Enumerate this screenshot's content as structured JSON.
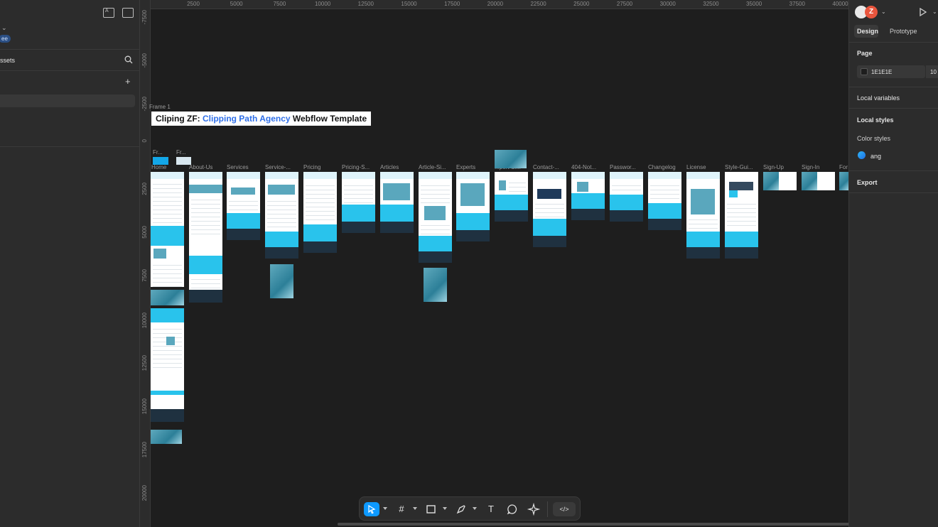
{
  "left_panel": {
    "badge": "ee",
    "assets_tab": "ssets"
  },
  "canvas": {
    "ruler_top": [
      "2500",
      "5000",
      "7500",
      "10000",
      "12500",
      "15000",
      "17500",
      "20000",
      "22500",
      "25000",
      "27500",
      "30000",
      "32500",
      "35000",
      "37500",
      "40000"
    ],
    "ruler_left": [
      "-7500",
      "-5000",
      "-2500",
      "0",
      "2500",
      "5000",
      "7500",
      "10000",
      "12500",
      "15000",
      "17500",
      "20000"
    ],
    "frame_name": "Frame 1",
    "title_prefix": "Cliping ZF: ",
    "title_accent": "Clipping Path Agency",
    "title_suffix": " Webflow Template",
    "small_labels": [
      "Fr...",
      "Fr..."
    ],
    "pages": [
      "Home",
      "About-Us",
      "Services",
      "Service-...",
      "Pricing",
      "Pricing-S...",
      "Articles",
      "Article-Si...",
      "Experts",
      "...pert-Si...",
      "Contact-...",
      "404-Not...",
      "Passwor...",
      "Changelog",
      "License",
      "Style-Gui...",
      "Sign-Up",
      "Sign-In",
      "For"
    ]
  },
  "toolbar": {
    "tools": [
      "move-tool",
      "frame-tool",
      "shape-tool",
      "pen-tool",
      "text-tool",
      "comment-tool",
      "actions-tool",
      "dev-mode"
    ],
    "text_glyph": "T",
    "frame_glyph": "#",
    "dev_glyph": "</>"
  },
  "right_panel": {
    "avatar_letter": "Z",
    "tabs": [
      "Design",
      "Prototype"
    ],
    "page_heading": "Page",
    "page_color": "1E1E1E",
    "page_opacity": "10",
    "local_variables": "Local variables",
    "local_styles": "Local styles",
    "color_styles": "Color styles",
    "color_style_name": "ang",
    "export": "Export"
  },
  "colors": {
    "canvas_bg": "#1e1e1e",
    "panel_bg": "#2c2c2c",
    "accent_blue": "#0d99ff",
    "title_accent": "#2f6fe8",
    "brand_cyan": "#29c3ec",
    "avatar_orange": "#e8553d"
  }
}
